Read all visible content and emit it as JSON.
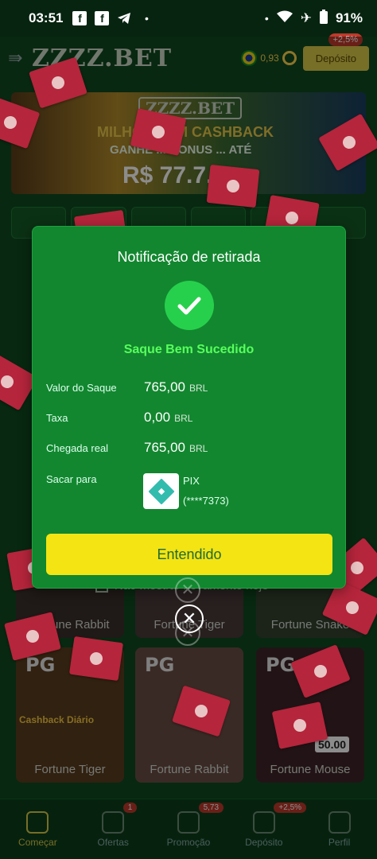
{
  "status_bar": {
    "time": "03:51",
    "battery": "91%"
  },
  "app": {
    "logo": "ZZZZ.BET",
    "balance": "0,93",
    "deposit_label": "Depósito",
    "deposit_badge": "+2,5%",
    "banner": {
      "logo": "ZZZZ.BET",
      "headline": "MILHÕES EM CASHBACK",
      "sub": "GANHE ... BONUS ... ATÉ",
      "amount": "R$ 77.7..."
    },
    "no_more_today": "Não mostrar novamente hoje",
    "games_row1": [
      "Fortune Rabbit",
      "Fortune Tiger",
      "Fortune Snake"
    ],
    "games_row2": [
      "Fortune Tiger",
      "Fortune Rabbit",
      "Fortune Mouse"
    ],
    "cashback_label": "Cashback Diário",
    "prize_amount": "50.00",
    "bottom_nav": [
      {
        "label": "Começar",
        "badge": ""
      },
      {
        "label": "Ofertas",
        "badge": "1"
      },
      {
        "label": "Promoção",
        "badge": "5,73"
      },
      {
        "label": "Depósito",
        "badge": "+2,5%"
      },
      {
        "label": "Perfil",
        "badge": ""
      }
    ]
  },
  "modal": {
    "title": "Notificação de retirada",
    "status": "Saque Bem Sucedido",
    "rows": [
      {
        "label": "Valor do Saque",
        "value": "765,00",
        "currency": "BRL"
      },
      {
        "label": "Taxa",
        "value": "0,00",
        "currency": "BRL"
      },
      {
        "label": "Chegada real",
        "value": "765,00",
        "currency": "BRL"
      }
    ],
    "withdraw_to_label": "Sacar para",
    "method_name": "PIX",
    "account": "(****7373)",
    "confirm_button": "Entendido"
  },
  "colors": {
    "modal_bg": "#12872f",
    "success_text": "#57ff5c",
    "button": "#f4e413"
  }
}
